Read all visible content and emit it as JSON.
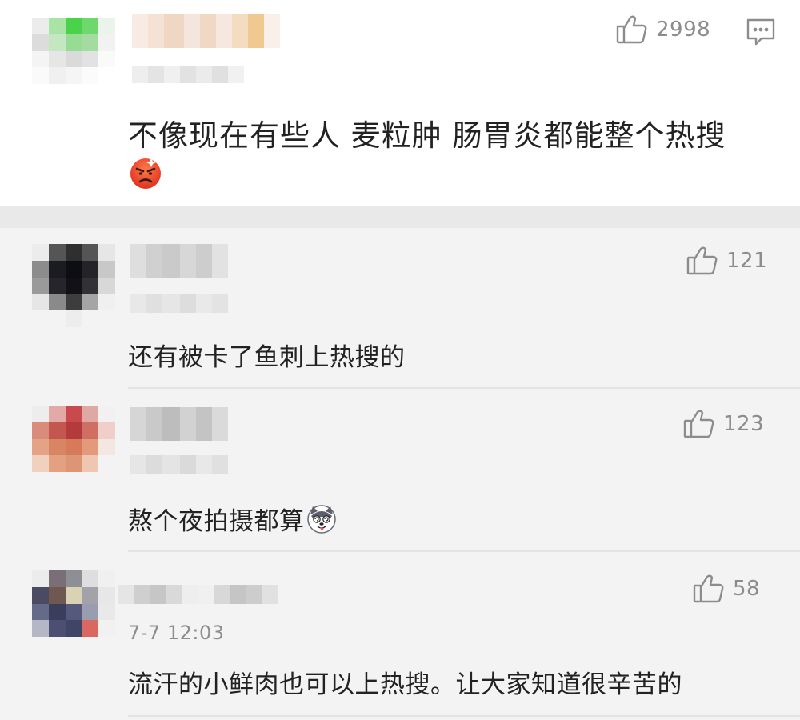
{
  "main_comment": {
    "like_count": "2998",
    "text": "不像现在有些人 麦粒肿 肠胃炎都能整个热搜",
    "emoji": "angry-face-emoji"
  },
  "replies": [
    {
      "like_count": "121",
      "text": "还有被卡了鱼刺上热搜的"
    },
    {
      "like_count": "123",
      "text": "熬个夜拍摄都算",
      "emoji": "husky-dog-emoji"
    },
    {
      "like_count": "58",
      "time": "7-7 12:03",
      "text": "流汗的小鲜肉也可以上热搜。让大家知道很辛苦的"
    }
  ],
  "icons": {
    "like": "thumbs-up-icon",
    "reply": "comment-bubble-icon"
  },
  "colors": {
    "text": "#222222",
    "meta": "#8c8c8c",
    "main_background": "#ffffff",
    "reply_background": "#f3f3f3"
  }
}
